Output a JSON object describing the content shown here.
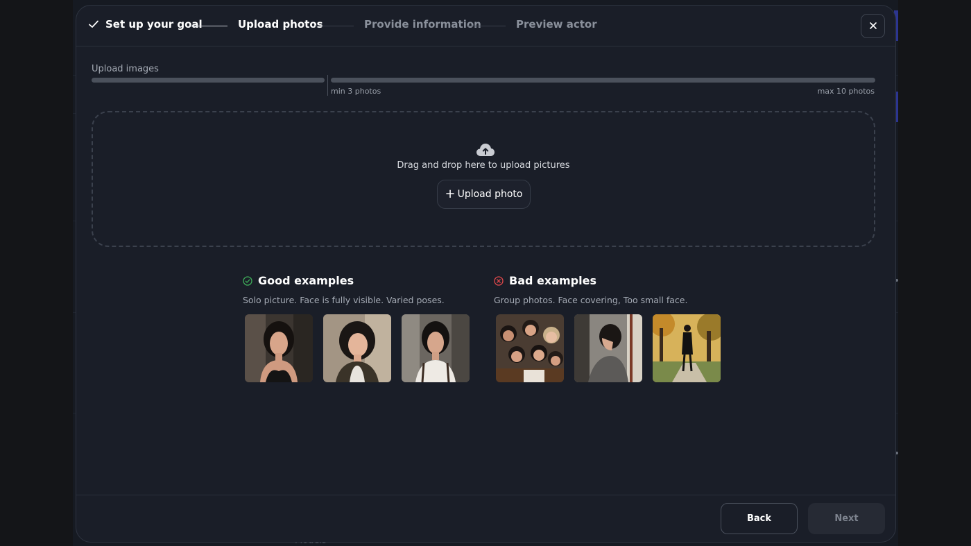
{
  "stepper": {
    "steps": [
      {
        "label": "Set up your goal",
        "state": "done"
      },
      {
        "label": "Upload photos",
        "state": "active"
      },
      {
        "label": "Provide information",
        "state": "pending"
      },
      {
        "label": "Preview actor",
        "state": "pending"
      }
    ],
    "close_icon": "close-icon"
  },
  "upload": {
    "label": "Upload images",
    "min_label": "min 3 photos",
    "max_label": "max 10 photos",
    "uploaded_count": 0
  },
  "dropzone": {
    "icon": "cloud-upload-icon",
    "text": "Drag and drop here to upload pictures",
    "button_label": "Upload photo"
  },
  "examples": {
    "good": {
      "title": "Good examples",
      "subtitle": "Solo picture. Face is fully visible. Varied poses.",
      "icon": "check-circle-icon",
      "color": "#3fae5a"
    },
    "bad": {
      "title": "Bad examples",
      "subtitle": "Group photos. Face covering, Too small face.",
      "icon": "x-circle-icon",
      "color": "#e0484b"
    }
  },
  "footer": {
    "back_label": "Back",
    "next_label": "Next"
  },
  "background": {
    "partial_text": "Models"
  },
  "colors": {
    "modal_bg": "#1a1e28",
    "accent": "#2c3590"
  }
}
